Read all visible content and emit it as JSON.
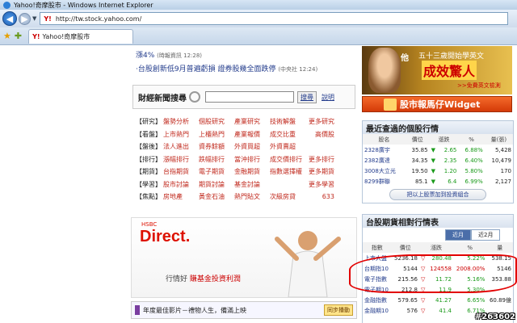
{
  "window": {
    "title": "Yahoo!奇摩股市 - Windows Internet Explorer"
  },
  "address": {
    "url": "http://tw.stock.yahoo.com/"
  },
  "tab": {
    "label": "Yahoo!奇摩股市"
  },
  "news": {
    "line1_text": "漲4%",
    "line1_time": "(時報資訊 12:28)",
    "line2_text": "‧台股創新低9月普遍虧損 證券股幾全面跌停",
    "line2_time": "(中央社 12:24)"
  },
  "search": {
    "label": "財經新聞搜尋",
    "button": "搜尋",
    "help": "說明",
    "value": ""
  },
  "links": [
    {
      "cat": "【研究】",
      "items": [
        "盤勢分析",
        "個股研究",
        "產業研究",
        "技術解盤"
      ],
      "last": "更多研究"
    },
    {
      "cat": "【看盤】",
      "items": [
        "上市熱門",
        "上櫃熱門",
        "產業報價",
        "成交比重"
      ],
      "last": "高價股"
    },
    {
      "cat": "【盤後】",
      "items": [
        "法人進出",
        "資券餘額",
        "外資買超",
        "外資賣超"
      ],
      "last": ""
    },
    {
      "cat": "【排行】",
      "items": [
        "漲幅排行",
        "跌幅排行",
        "當沖排行",
        "成交價排行"
      ],
      "last": "更多排行"
    },
    {
      "cat": "【期貨】",
      "items": [
        "台指期貨",
        "電子期貨",
        "金融期貨",
        "指數選擇權"
      ],
      "last": "更多期貨"
    },
    {
      "cat": "【學習】",
      "items": [
        "股市討論",
        "期貨討論",
        "基金討論",
        ""
      ],
      "last": "更多學習"
    },
    {
      "cat": "【焦點】",
      "items": [
        "房地產",
        "黃金石油",
        "熱門貼文",
        "次級房貸"
      ],
      "last": "633"
    }
  ],
  "ad": {
    "brand": "HSBC",
    "headline": "Direct.",
    "slogan_a": "行情好",
    "slogan_b": "賺基金投資利潤"
  },
  "promo": {
    "text": "年度最佳影片－禮物人生，備滿上映",
    "button": "同步播動"
  },
  "banner": {
    "left": "他",
    "top": "五十三歲開始學英文",
    "big": "成效驚人",
    "sub": ">>免費英文檢測"
  },
  "widget": {
    "label": "股市報馬仔Widget"
  },
  "history": {
    "title": "最近查過的個股行情",
    "headers": [
      "股名",
      "價位",
      "漲跌",
      "%",
      "量(張)"
    ],
    "rows": [
      [
        "2328廣宇",
        "35.85",
        "▼",
        "2.65",
        "6.88%",
        "5,428"
      ],
      [
        "2382廣達",
        "34.35",
        "▼",
        "2.35",
        "6.40%",
        "10,479"
      ],
      [
        "3008大立光",
        "19.50",
        "▼",
        "1.20",
        "5.80%",
        "170"
      ],
      [
        "8299群聯",
        "85.1",
        "▼",
        "6.4",
        "6.99%",
        "2,127"
      ]
    ],
    "add_button": "把以上股票加到投資組合"
  },
  "futures": {
    "title": "台股期貨相對行情表",
    "tabs": [
      "近月",
      "近2月"
    ],
    "headers": [
      "指數",
      "價位",
      "漲跌",
      "%",
      "量"
    ],
    "rows": [
      [
        "上市大盤",
        "5236.18",
        "▽",
        "280.48",
        "5.22%",
        "538.15"
      ],
      [
        "台期指10",
        "5144",
        "▽",
        "124558",
        "2008.00%",
        "5146"
      ],
      [
        "電子指數",
        "215.56",
        "▽",
        "11.72",
        "5.16%",
        "353.88"
      ],
      [
        "電子期10",
        "212.8",
        "▽",
        "11.9",
        "5.30%",
        ""
      ],
      [
        "金融指數",
        "579.65",
        "▽",
        "41.27",
        "6.65%",
        "60.89億"
      ],
      [
        "金融期10",
        "576",
        "▽",
        "41.4",
        "6.71%",
        ""
      ]
    ]
  },
  "watermark": {
    "text": "#263602"
  },
  "colors": {
    "link_red": "#c0281c",
    "link_blue": "#233c8c",
    "up_green": "#1a9a1a"
  }
}
